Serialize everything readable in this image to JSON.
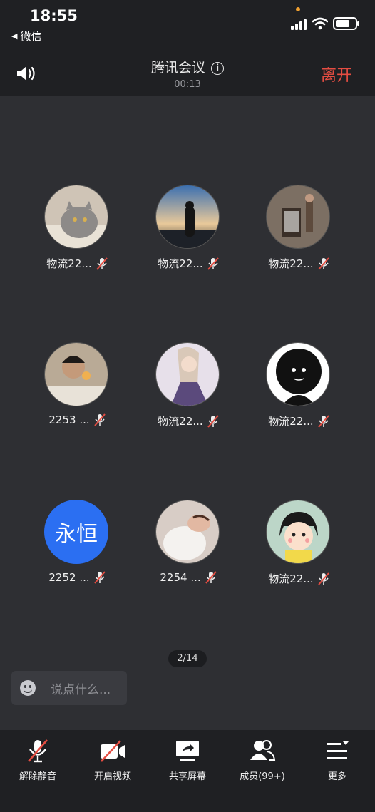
{
  "status_bar": {
    "time": "18:55",
    "back_app": "微信"
  },
  "header": {
    "title": "腾讯会议",
    "duration": "00:13",
    "leave_label": "离开"
  },
  "participants": [
    {
      "name": "物流22...",
      "avatar": "cat-photo"
    },
    {
      "name": "物流22...",
      "avatar": "sunset-person-photo"
    },
    {
      "name": "物流22...",
      "avatar": "room-poster-photo"
    },
    {
      "name": "2253 ...",
      "avatar": "boy-photo"
    },
    {
      "name": "物流22...",
      "avatar": "anime-character"
    },
    {
      "name": "物流22...",
      "avatar": "black-creature-cartoon"
    },
    {
      "name": "2252 ...",
      "avatar_text": "永恒",
      "avatar_color": "#2b6ff2"
    },
    {
      "name": "2254 ...",
      "avatar": "girl-selfie-photo"
    },
    {
      "name": "物流22...",
      "avatar": "chibi-maruko-cartoon"
    }
  ],
  "pager": "2/14",
  "chat": {
    "placeholder": "说点什么..."
  },
  "toolbar": [
    {
      "label": "解除静音",
      "icon": "mic-off-icon"
    },
    {
      "label": "开启视频",
      "icon": "video-off-icon"
    },
    {
      "label": "共享屏幕",
      "icon": "share-screen-icon"
    },
    {
      "label": "成员(99+)",
      "icon": "members-icon"
    },
    {
      "label": "更多",
      "icon": "more-menu-icon"
    }
  ],
  "colors": {
    "leave": "#e54d42",
    "mute_slash": "#e54d42",
    "avatar_blue": "#2b6ff2"
  }
}
